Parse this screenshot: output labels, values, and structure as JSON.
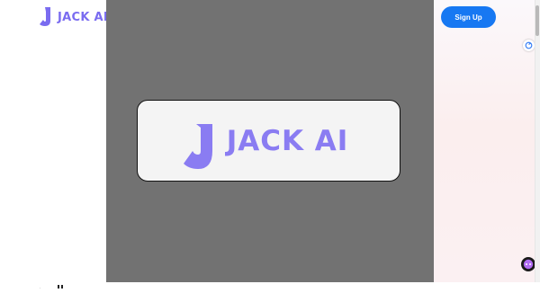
{
  "header": {
    "logo_text": "JACK AI",
    "signup_label": "Sign Up"
  },
  "modal": {
    "logo_text": "JACK AI"
  },
  "colors": {
    "brand_purple": "#7a6cf0",
    "signup_blue": "#1778f2",
    "overlay_gray": "#727272"
  },
  "icons": {
    "float_icon": "refresh-icon",
    "chat_icon": "chat-icon"
  }
}
